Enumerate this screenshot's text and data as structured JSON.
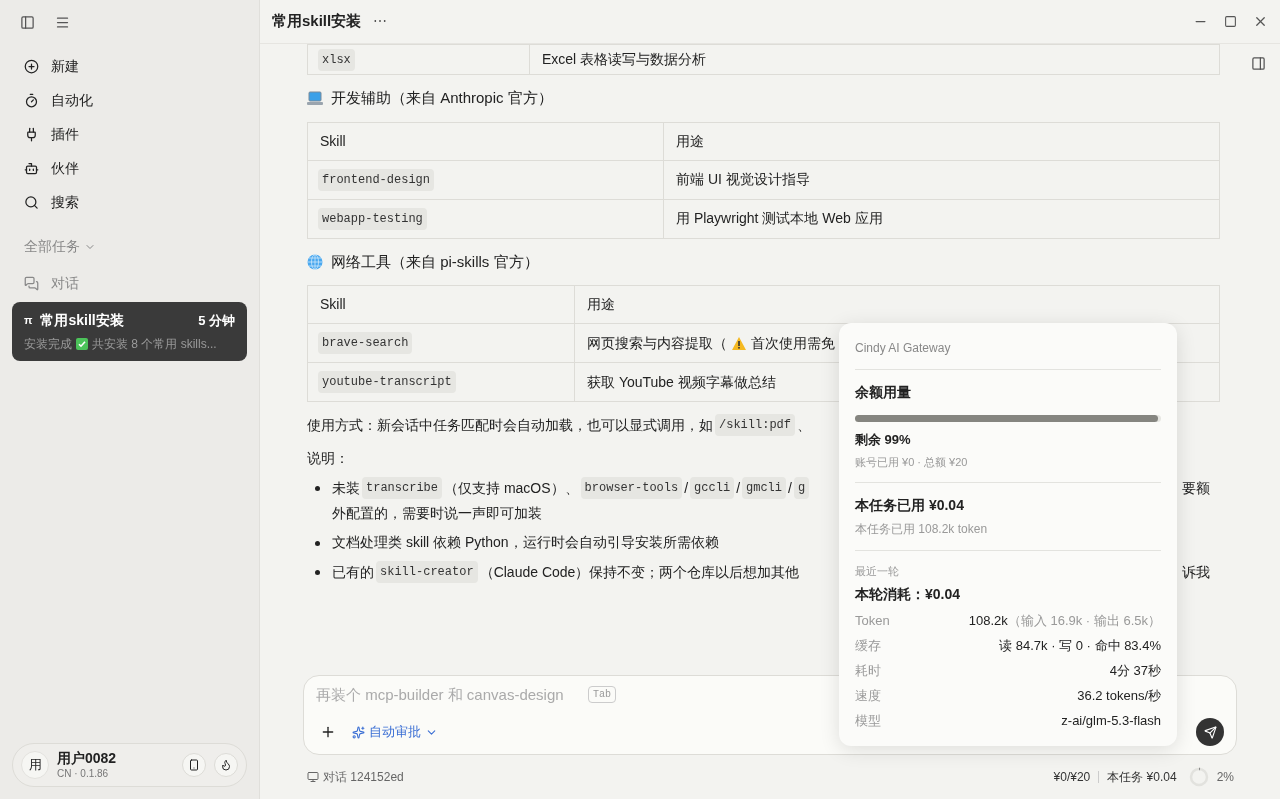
{
  "sidebar": {
    "nav": [
      {
        "kind": "new",
        "label": "新建"
      },
      {
        "kind": "automation",
        "label": "自动化"
      },
      {
        "kind": "plugin",
        "label": "插件"
      },
      {
        "kind": "partner",
        "label": "伙伴"
      },
      {
        "kind": "search",
        "label": "搜索"
      }
    ],
    "section": "全部任务",
    "group": "对话",
    "tasks": [
      {
        "badge": "π",
        "title": "常用skill安装",
        "time": "5 分钟",
        "summary_before": "安装完成",
        "summary_after": "共安装 8 个常用 skills...",
        "selected": true
      }
    ],
    "user": {
      "avatar": "用",
      "name": "用户0082",
      "meta": "CN · 0.1.86"
    }
  },
  "header": {
    "title": "常用skill安装",
    "more": "⋯"
  },
  "content": {
    "top_table": {
      "rows": [
        {
          "skill": "xlsx",
          "use": [
            {
              "kind": "text",
              "text": "Excel 表格读写与数据分析"
            }
          ]
        }
      ]
    },
    "sections": [
      {
        "kind": "computer",
        "heading": "开发辅助（来自 Anthropic 官方）",
        "columns": [
          "Skill",
          "用途"
        ],
        "rows": [
          {
            "skill": "frontend-design",
            "use": [
              {
                "kind": "text",
                "text": "前端 UI 视觉设计指导"
              }
            ]
          },
          {
            "skill": "webapp-testing",
            "use": [
              {
                "kind": "text",
                "text": "用 Playwright 测试本地 Web 应用"
              }
            ]
          }
        ]
      },
      {
        "kind": "globe",
        "heading": "网络工具（来自 pi-skills 官方）",
        "columns": [
          "Skill",
          "用途"
        ],
        "rows": [
          {
            "skill": "brave-search",
            "use": [
              {
                "kind": "text",
                "text": "网页搜索与内容提取（"
              },
              {
                "kind": "warning"
              },
              {
                "kind": "text",
                "text": "首次使用需免"
              }
            ]
          },
          {
            "skill": "youtube-transcript",
            "use": [
              {
                "kind": "text",
                "text": "获取 YouTube 视频字幕做总结"
              }
            ]
          }
        ]
      }
    ],
    "usage": [
      {
        "kind": "text",
        "text": "使用方式：新会话中任务匹配时会自动加载，也可以显式调用，如"
      },
      {
        "kind": "code",
        "text": "/skill:pdf"
      },
      {
        "kind": "text",
        "text": "、"
      }
    ],
    "note_label": "说明：",
    "bullets": [
      {
        "line": [
          {
            "kind": "text",
            "text": "未装"
          },
          {
            "kind": "code",
            "text": "transcribe"
          },
          {
            "kind": "text",
            "text": "（仅支持 macOS）、"
          },
          {
            "kind": "code",
            "text": "browser-tools"
          },
          {
            "kind": "text",
            "text": "/"
          },
          {
            "kind": "code",
            "text": "gccli"
          },
          {
            "kind": "text",
            "text": "/"
          },
          {
            "kind": "code",
            "text": "gmcli"
          },
          {
            "kind": "text",
            "text": "/"
          },
          {
            "kind": "code",
            "text": "g"
          }
        ],
        "tail": "要额",
        "wrap": "外配置的，需要时说一声即可加装"
      },
      {
        "line": [
          {
            "kind": "text",
            "text": "文档处理类 skill 依赖 Python，运行时会自动引导安装所需依赖"
          }
        ]
      },
      {
        "line": [
          {
            "kind": "text",
            "text": "已有的"
          },
          {
            "kind": "code",
            "text": "skill-creator"
          },
          {
            "kind": "text",
            "text": "（Claude Code）保持不变；两个仓库以后想加其他"
          }
        ],
        "tail": "诉我"
      }
    ]
  },
  "composer": {
    "placeholder": "再装个 mcp-builder 和 canvas-design",
    "hint_key": "Tab",
    "approval": "自动审批"
  },
  "footer": {
    "conversation": "对话 124152ed",
    "balance": "¥0/¥20",
    "task_cost": "本任务 ¥0.04",
    "context": "2%",
    "level": 0.02
  },
  "popover": {
    "title": "Cindy AI Gateway",
    "quota_title": "余额用量",
    "level": 0.99,
    "remaining": "剩余 99%",
    "account": "账号已用 ¥0 · 总额 ¥20",
    "task_cost": "本任务已用 ¥0.04",
    "task_tokens": "本任务已用 108.2k token",
    "recent_label": "最近一轮",
    "round_cost": "本轮消耗：¥0.04",
    "stats": [
      {
        "label": "Token",
        "value": "108.2k",
        "extra": "（输入 16.9k · 输出 6.5k）"
      },
      {
        "label": "缓存",
        "value": "读 84.7k · 写 0 · 命中 83.4%"
      },
      {
        "label": "耗时",
        "value": "4分 37秒"
      },
      {
        "label": "速度",
        "value": "36.2 tokens/秒"
      },
      {
        "label": "模型",
        "value": "z-ai/glm-5.3-flash"
      }
    ]
  }
}
